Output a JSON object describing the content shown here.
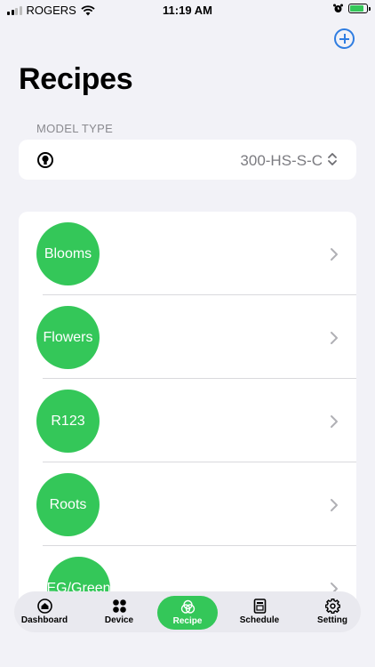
{
  "status_bar": {
    "carrier": "ROGERS",
    "time": "11:19 AM"
  },
  "header": {
    "title": "Recipes",
    "add_icon": "plus-circle-icon"
  },
  "model_type": {
    "label": "MODEL TYPE",
    "value": "300-HS-S-C"
  },
  "recipes": [
    {
      "name": "Blooms"
    },
    {
      "name": "Flowers"
    },
    {
      "name": "R123"
    },
    {
      "name": "Roots"
    },
    {
      "name": "EG/Green"
    }
  ],
  "tabs": [
    {
      "label": "Dashboard",
      "icon": "home-icon",
      "active": false
    },
    {
      "label": "Device",
      "icon": "grid-dots-icon",
      "active": false
    },
    {
      "label": "Recipe",
      "icon": "recipe-icon",
      "active": true
    },
    {
      "label": "Schedule",
      "icon": "schedule-icon",
      "active": false
    },
    {
      "label": "Setting",
      "icon": "gear-icon",
      "active": false
    }
  ],
  "colors": {
    "accent_green": "#34c759",
    "accent_blue": "#2f7de1",
    "background": "#f2f2f7"
  }
}
